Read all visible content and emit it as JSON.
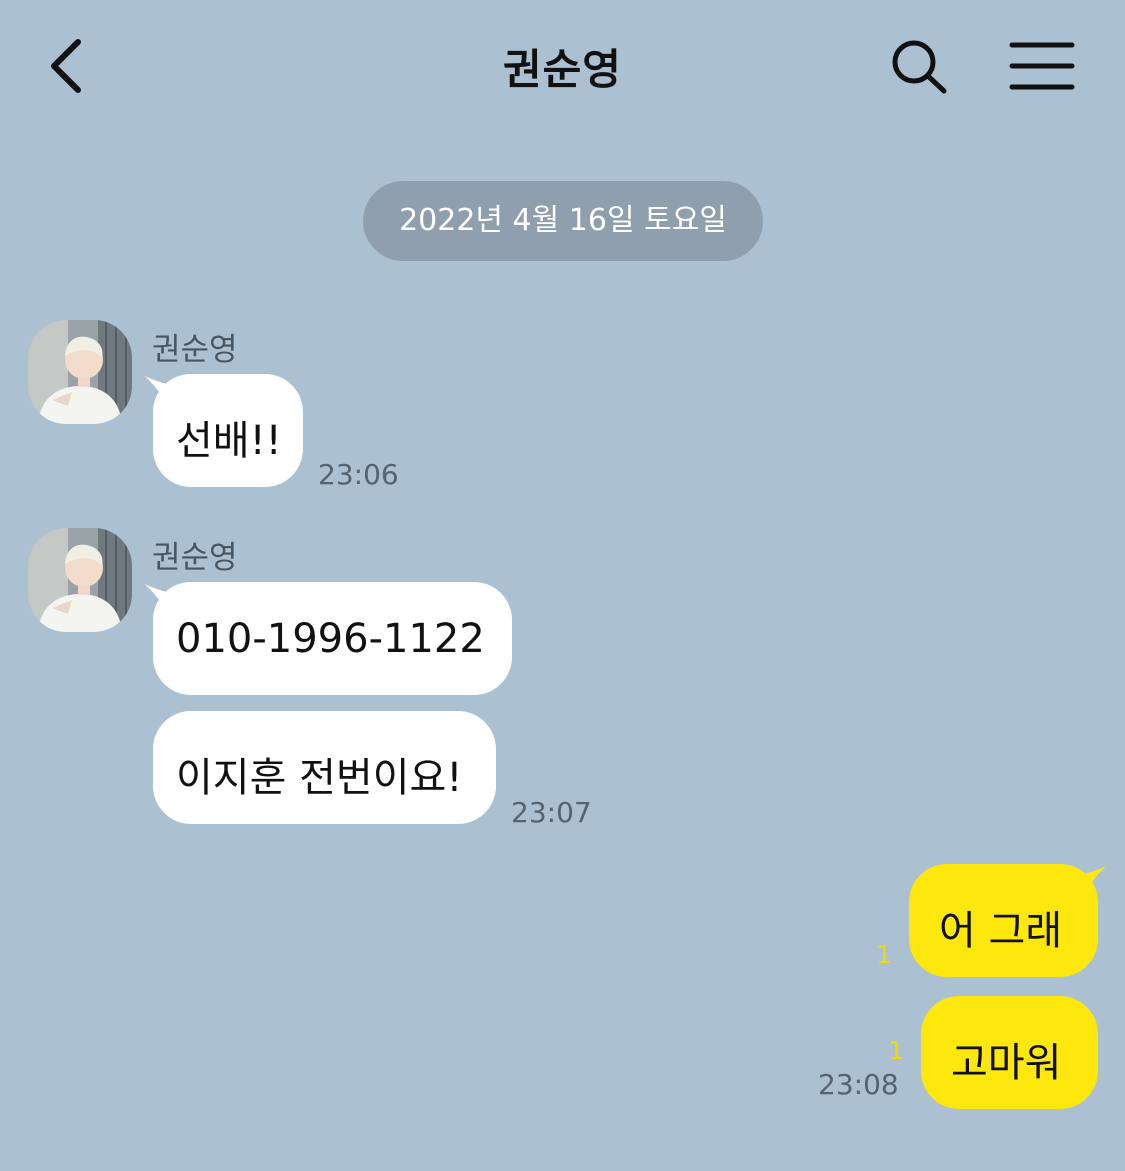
{
  "header": {
    "title": "권순영"
  },
  "date_divider": "2022년 4월 16일 토요일",
  "messages": {
    "g1": {
      "sender": "권순영",
      "bubbles": [
        "선배!!"
      ],
      "time": "23:06"
    },
    "g2": {
      "sender": "권순영",
      "bubbles": [
        "010-1996-1122",
        "이지훈 전번이요!"
      ],
      "time": "23:07"
    },
    "g3": {
      "bubbles": [
        "어 그래",
        "고마워"
      ],
      "unread": [
        "1",
        "1"
      ],
      "time": "23:08"
    }
  },
  "icons": {
    "back": "chevron-left-icon",
    "search": "search-icon",
    "menu": "hamburger-menu-icon",
    "avatar": "profile-photo"
  },
  "colors": {
    "background": "#abc1d1",
    "incoming_bubble": "#ffffff",
    "outgoing_bubble": "#fde70c",
    "date_pill": "#909fad",
    "unread_count": "#f3d900"
  }
}
